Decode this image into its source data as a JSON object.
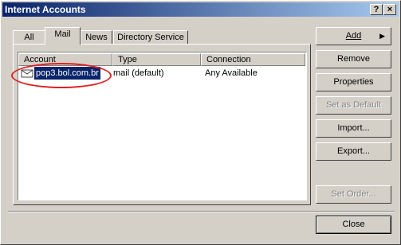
{
  "window": {
    "title": "Internet Accounts",
    "help_glyph": "?",
    "close_glyph": "×"
  },
  "tabs": [
    {
      "label": "All"
    },
    {
      "label": "Mail",
      "active": true
    },
    {
      "label": "News"
    },
    {
      "label": "Directory Service"
    }
  ],
  "list": {
    "columns": [
      "Account",
      "Type",
      "Connection"
    ],
    "rows": [
      {
        "account": "pop3.bol.com.br",
        "type": "mail (default)",
        "connection": "Any Available",
        "icon": "mail-account-icon",
        "selected": true
      }
    ]
  },
  "buttons": {
    "add": "Add",
    "remove": "Remove",
    "properties": "Properties",
    "set_default": "Set as Default",
    "import": "Import...",
    "export": "Export...",
    "set_order": "Set Order...",
    "close": "Close"
  },
  "colors": {
    "titlebar_start": "#0a246a",
    "titlebar_end": "#a6caf0",
    "selection": "#0a246a",
    "annotation": "#e02020"
  }
}
